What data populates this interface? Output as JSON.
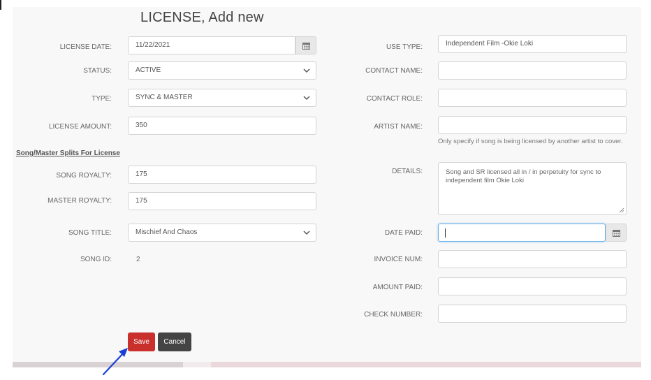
{
  "form": {
    "title": "LICENSE, Add new",
    "labels": {
      "license_date": "LICENSE DATE:",
      "status": "STATUS:",
      "type": "TYPE:",
      "license_amount": "LICENSE AMOUNT:",
      "splits_heading": "Song/Master Splits For License",
      "song_royalty": "SONG ROYALTY:",
      "master_royalty": "MASTER ROYALTY:",
      "song_title": "SONG TITLE:",
      "song_id": "SONG ID:",
      "use_type": "USE TYPE:",
      "contact_name": "CONTACT NAME:",
      "contact_role": "CONTACT ROLE:",
      "artist_name": "ARTIST NAME:",
      "details": "DETAILS:",
      "date_paid": "DATE PAID:",
      "invoice_num": "INVOICE NUM:",
      "amount_paid": "AMOUNT PAID:",
      "check_number": "CHECK NUMBER:"
    },
    "values": {
      "license_date": "11/22/2021",
      "status": "ACTIVE",
      "type": "SYNC & MASTER",
      "license_amount": "350",
      "song_royalty": "175",
      "master_royalty": "175",
      "song_title": "Mischief And Chaos",
      "song_id": "2",
      "use_type": "Independent Film -Okie Loki",
      "contact_name": "",
      "contact_role": "",
      "artist_name": "",
      "details": "Song and SR licensed all in / in perpetuity for sync to independent film Okie Loki",
      "date_paid": "",
      "invoice_num": "",
      "amount_paid": "",
      "check_number": ""
    },
    "artist_help": "Only specify if song is being licensed by another artist to cover.",
    "buttons": {
      "save": "Save",
      "cancel": "Cancel"
    }
  },
  "colors": {
    "save_button": "#c9302c",
    "cancel_button": "#444444",
    "focus_border": "#66afe9",
    "arrow": "#1a3fd6"
  },
  "icons": {
    "calendar": "calendar-icon",
    "dropdown": "chevron-down-icon",
    "annotation": "arrow-icon"
  }
}
